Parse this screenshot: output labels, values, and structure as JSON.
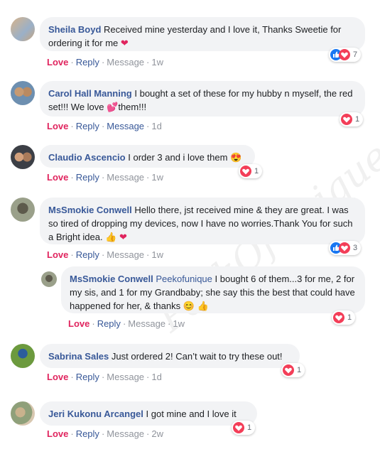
{
  "watermark": "PeekOfUnique",
  "comments": [
    {
      "author": "Sheila Boyd",
      "text": "Received mine yesterday and I love it, Thanks Sweetie for ordering it for me",
      "love": "Love",
      "reply": "Reply",
      "message": "Message",
      "time": "1w",
      "reactions": "7"
    },
    {
      "author": "Carol Hall Manning",
      "text1": "I bought a set of these for my hubby n myself, the red set!!! We love",
      "text2": "them!!!",
      "love": "Love",
      "reply": "Reply",
      "message": "Message",
      "time": "1d",
      "reactions": "1"
    },
    {
      "author": "Claudio Ascencio",
      "text": "I order 3 and i love them",
      "love": "Love",
      "reply": "Reply",
      "message": "Message",
      "time": "1w",
      "reactions": "1"
    },
    {
      "author": "MsSmokie Conwell",
      "text": "Hello there, jst received mine & they are great. I was so tired of dropping my devices, now I have no worries.Thank You for such a Bright idea.",
      "love": "Love",
      "reply": "Reply",
      "message": "Message",
      "time": "1w",
      "reactions": "3"
    },
    {
      "author": "MsSmokie Conwell",
      "mention": "Peekofunique",
      "text": "I bought 6 of them...3 for me, 2 for my sis, and 1 for my Grandbaby; she say this the best that could have happened for her, & thanks",
      "love": "Love",
      "reply": "Reply",
      "message": "Message",
      "time": "1w",
      "reactions": "1"
    },
    {
      "author": "Sabrina Sales",
      "text": "Just ordered 2! Can’t wait to try these out!",
      "love": "Love",
      "reply": "Reply",
      "message": "Message",
      "time": "1d",
      "reactions": "1"
    },
    {
      "author": "Jeri Kukonu Arcangel",
      "text": "I got mine and I love it",
      "love": "Love",
      "reply": "Reply",
      "message": "Message",
      "time": "2w",
      "reactions": "1"
    }
  ],
  "colors": {
    "author": "#385898",
    "love": "#e0245e",
    "bubble": "#f2f3f5",
    "like": "#1877f2",
    "heart": "#f33e58"
  },
  "icons": [
    "heart-emoji",
    "heart-eyes-emoji",
    "thumbs-up-emoji",
    "smile-emoji",
    "like-reaction-icon",
    "love-reaction-icon"
  ]
}
